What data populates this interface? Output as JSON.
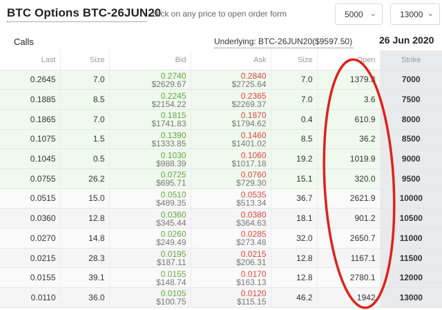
{
  "header": {
    "title": "BTC Options BTC-26JUN20",
    "hint": "click on any price to open order form",
    "min_strike": "5000",
    "max_strike": "13000"
  },
  "subheader": {
    "side": "Calls",
    "underlying": "Underlying: BTC-26JUN20($9597.50)",
    "expiry": "26 Jun 2020"
  },
  "columns": {
    "last": "Last",
    "size": "Size",
    "bid": "Bid",
    "ask": "Ask",
    "ask_size": "Size",
    "open": "Open",
    "strike": "Strike"
  },
  "rows": [
    {
      "last": "0.2645",
      "size": "7.0",
      "bid": "0.2740",
      "bid_usd": "$2629.67",
      "ask": "0.2840",
      "ask_usd": "$2725.64",
      "ask_size": "7.0",
      "open": "1379.3",
      "strike": "7000"
    },
    {
      "last": "0.1885",
      "size": "8.5",
      "bid": "0.2245",
      "bid_usd": "$2154.22",
      "ask": "0.2365",
      "ask_usd": "$2269.37",
      "ask_size": "7.0",
      "open": "3.6",
      "strike": "7500"
    },
    {
      "last": "0.1865",
      "size": "7.0",
      "bid": "0.1815",
      "bid_usd": "$1741.83",
      "ask": "0.1870",
      "ask_usd": "$1794.62",
      "ask_size": "0.4",
      "open": "610.9",
      "strike": "8000"
    },
    {
      "last": "0.1075",
      "size": "1.5",
      "bid": "0.1390",
      "bid_usd": "$1333.85",
      "ask": "0.1460",
      "ask_usd": "$1401.02",
      "ask_size": "8.5",
      "open": "36.2",
      "strike": "8500"
    },
    {
      "last": "0.1045",
      "size": "0.5",
      "bid": "0.1030",
      "bid_usd": "$988.39",
      "ask": "0.1060",
      "ask_usd": "$1017.18",
      "ask_size": "19.2",
      "open": "1019.9",
      "strike": "9000"
    },
    {
      "last": "0.0755",
      "size": "26.2",
      "bid": "0.0725",
      "bid_usd": "$695.71",
      "ask": "0.0760",
      "ask_usd": "$729.30",
      "ask_size": "15.1",
      "open": "320.0",
      "strike": "9500"
    },
    {
      "last": "0.0515",
      "size": "15.0",
      "bid": "0.0510",
      "bid_usd": "$489.35",
      "ask": "0.0535",
      "ask_usd": "$513.34",
      "ask_size": "36.7",
      "open": "2621.9",
      "strike": "10000"
    },
    {
      "last": "0.0360",
      "size": "12.8",
      "bid": "0.0360",
      "bid_usd": "$345.44",
      "ask": "0.0380",
      "ask_usd": "$364.63",
      "ask_size": "18.1",
      "open": "901.2",
      "strike": "10500"
    },
    {
      "last": "0.0270",
      "size": "14.8",
      "bid": "0.0260",
      "bid_usd": "$249.49",
      "ask": "0.0285",
      "ask_usd": "$273.48",
      "ask_size": "32.0",
      "open": "2650.7",
      "strike": "11000"
    },
    {
      "last": "0.0215",
      "size": "28.3",
      "bid": "0.0195",
      "bid_usd": "$187.11",
      "ask": "0.0215",
      "ask_usd": "$206.31",
      "ask_size": "12.8",
      "open": "1167.1",
      "strike": "11500"
    },
    {
      "last": "0.0155",
      "size": "39.1",
      "bid": "0.0155",
      "bid_usd": "$148.74",
      "ask": "0.0170",
      "ask_usd": "$163.13",
      "ask_size": "12.8",
      "open": "2780.1",
      "strike": "12000"
    },
    {
      "last": "0.0110",
      "size": "36.0",
      "bid": "0.0105",
      "bid_usd": "$100.75",
      "ask": "0.0120",
      "ask_usd": "$115.15",
      "ask_size": "46.2",
      "open": "1942",
      "strike": "13000"
    }
  ],
  "itm_rows": 6,
  "colors": {
    "bid": "#5ea83a",
    "ask": "#e0453d",
    "itm_background": "#f0f9ee",
    "strike_background": "#e8eaec",
    "annotation": "#e0201a"
  }
}
